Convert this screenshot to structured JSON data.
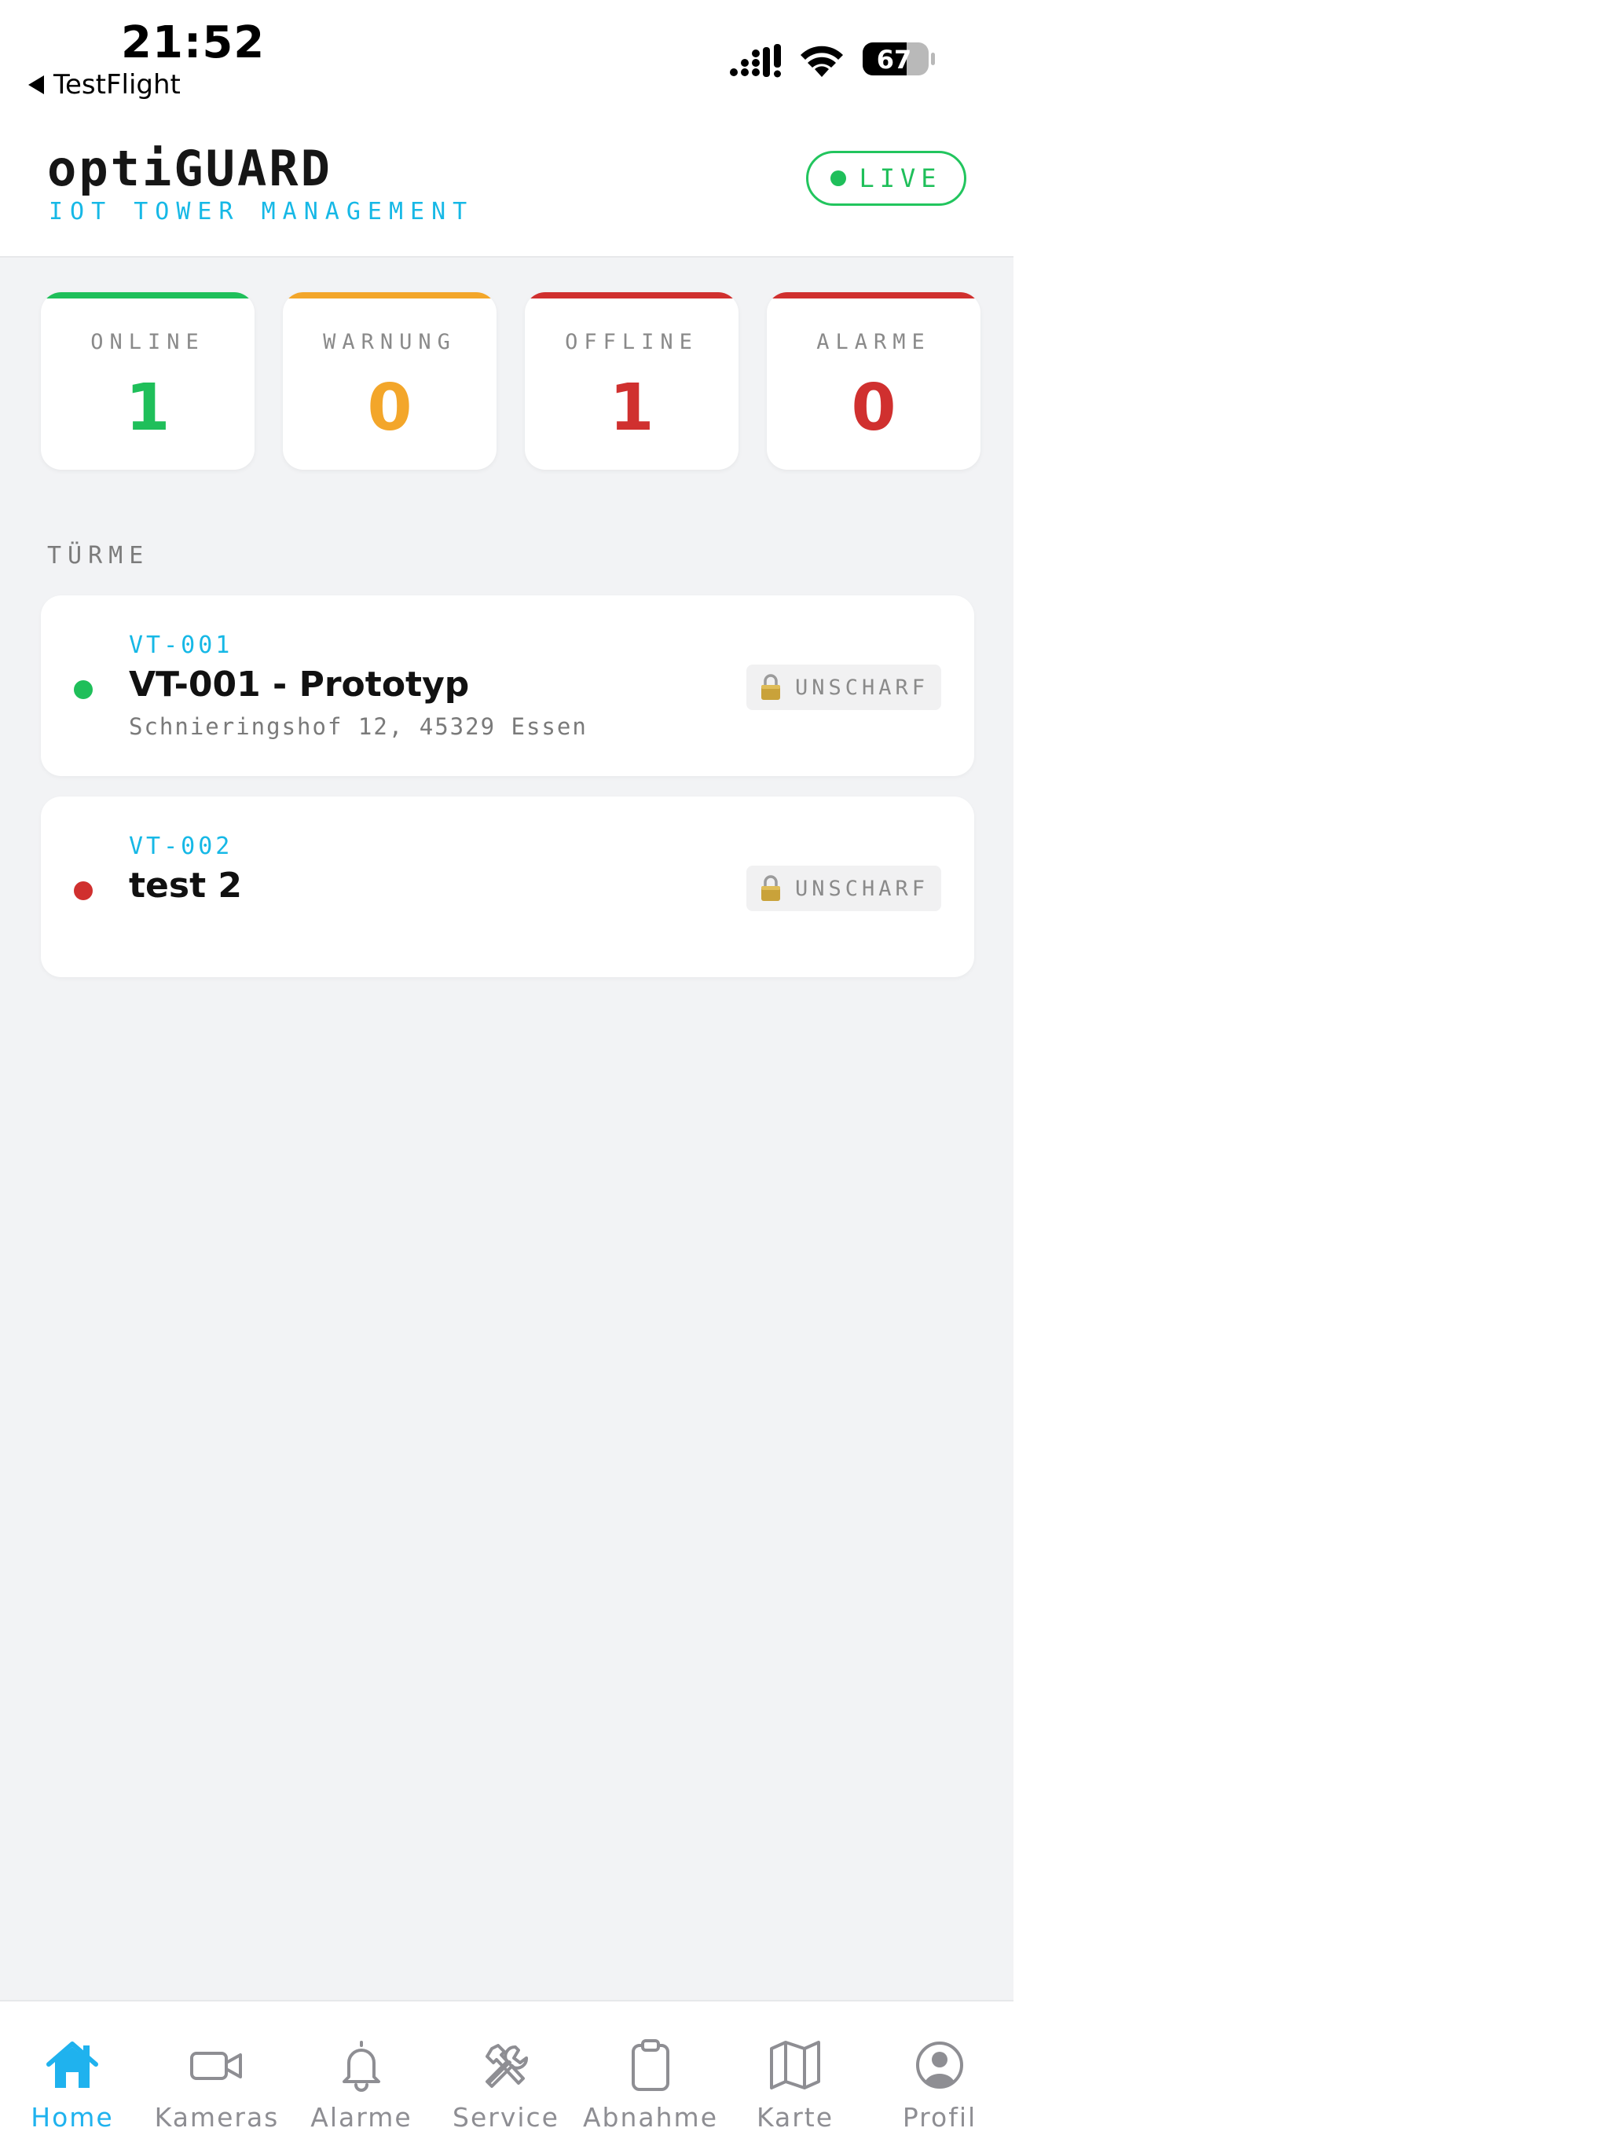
{
  "status_bar": {
    "time": "21:52",
    "back_app": "TestFlight",
    "battery": "67"
  },
  "header": {
    "title": "optiGUARD",
    "subtitle": "IOT TOWER MANAGEMENT",
    "live_label": "LIVE"
  },
  "stats": [
    {
      "label": "ONLINE",
      "value": "1",
      "color": "#1fbf5a"
    },
    {
      "label": "WARNUNG",
      "value": "0",
      "color": "#f3a62a"
    },
    {
      "label": "OFFLINE",
      "value": "1",
      "color": "#d0302f"
    },
    {
      "label": "ALARME",
      "value": "0",
      "color": "#d0302f"
    }
  ],
  "section_title": "TÜRME",
  "towers": [
    {
      "id": "VT-001",
      "name": "VT-001 - Prototyp",
      "address": "Schnieringshof 12, 45329 Essen",
      "status_color": "#1fbf5a",
      "arm_state": "UNSCHARF",
      "arm_icon": "lock-icon"
    },
    {
      "id": "VT-002",
      "name": "test 2",
      "address": "",
      "status_color": "#d0302f",
      "arm_state": "UNSCHARF",
      "arm_icon": "lock-icon"
    }
  ],
  "tabs": [
    {
      "label": "Home",
      "icon": "home-icon",
      "active": true
    },
    {
      "label": "Kameras",
      "icon": "video-camera-icon",
      "active": false
    },
    {
      "label": "Alarme",
      "icon": "bell-icon",
      "active": false
    },
    {
      "label": "Service",
      "icon": "tools-icon",
      "active": false
    },
    {
      "label": "Abnahme",
      "icon": "clipboard-icon",
      "active": false
    },
    {
      "label": "Karte",
      "icon": "map-icon",
      "active": false
    },
    {
      "label": "Profil",
      "icon": "user-circle-icon",
      "active": false
    }
  ],
  "colors": {
    "accent": "#1fb2ee",
    "online": "#1fbf5a",
    "warning": "#f3a62a",
    "offline": "#d0302f"
  }
}
